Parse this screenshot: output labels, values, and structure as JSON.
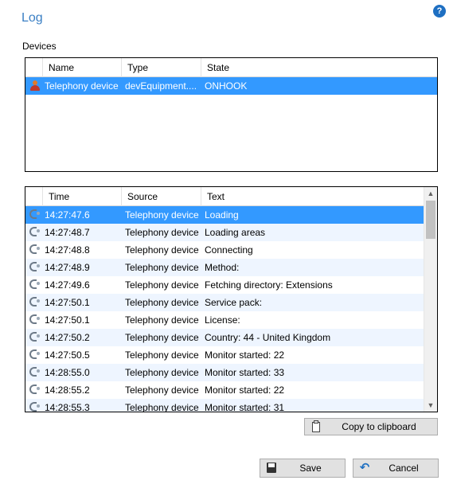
{
  "title": "Log",
  "devices_label": "Devices",
  "devices": {
    "columns": [
      "Name",
      "Type",
      "State"
    ],
    "rows": [
      {
        "name": "Telephony device",
        "type": "devEquipment....",
        "state": "ONHOOK"
      }
    ]
  },
  "log": {
    "columns": [
      "Time",
      "Source",
      "Text"
    ],
    "rows": [
      {
        "time": "14:27:47.6",
        "source": "Telephony device",
        "text": "Loading"
      },
      {
        "time": "14:27:48.7",
        "source": "Telephony device",
        "text": "Loading areas"
      },
      {
        "time": "14:27:48.8",
        "source": "Telephony device",
        "text": "Connecting"
      },
      {
        "time": "14:27:48.9",
        "source": "Telephony device",
        "text": "Method:"
      },
      {
        "time": "14:27:49.6",
        "source": "Telephony device",
        "text": "Fetching directory: Extensions"
      },
      {
        "time": "14:27:50.1",
        "source": "Telephony device",
        "text": "Service pack:"
      },
      {
        "time": "14:27:50.1",
        "source": "Telephony device",
        "text": "License:"
      },
      {
        "time": "14:27:50.2",
        "source": "Telephony device",
        "text": "Country: 44 - United Kingdom"
      },
      {
        "time": "14:27:50.5",
        "source": "Telephony device",
        "text": "Monitor started: 22"
      },
      {
        "time": "14:28:55.0",
        "source": "Telephony device",
        "text": "Monitor started: 33"
      },
      {
        "time": "14:28:55.2",
        "source": "Telephony device",
        "text": "Monitor started: 22"
      },
      {
        "time": "14:28:55.3",
        "source": "Telephony device",
        "text": "Monitor started: 31"
      }
    ]
  },
  "buttons": {
    "copy": "Copy to clipboard",
    "save": "Save",
    "cancel": "Cancel"
  },
  "icons": {
    "help": "?",
    "device_row": "person-icon",
    "log_row": "phone-icon"
  },
  "colors": {
    "title": "#3a7fc4",
    "selection": "#3399ff",
    "alt_row": "#eef5ff"
  }
}
